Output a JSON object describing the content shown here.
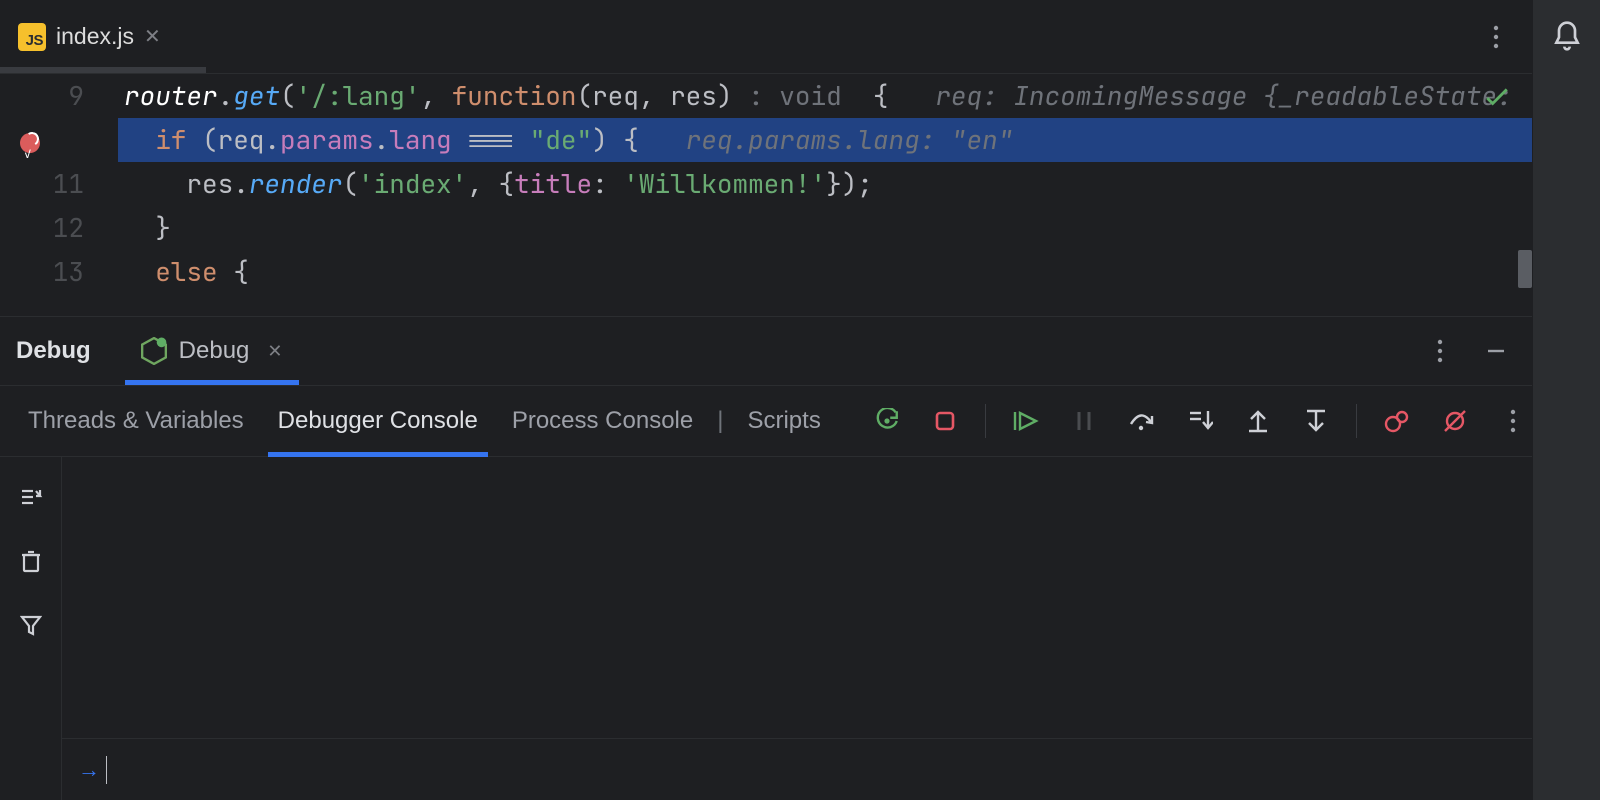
{
  "tab": {
    "icon_text": "JS",
    "title": "index.js"
  },
  "editor": {
    "lines": [
      {
        "num": "9"
      },
      {
        "num": ""
      },
      {
        "num": "11"
      },
      {
        "num": "12"
      },
      {
        "num": "13"
      }
    ],
    "row9": {
      "id": "router",
      "fn": "get",
      "route_str": "'/:lang'",
      "kw_func": "function",
      "params": "req, res",
      "ret_hint": ": void",
      "inlay": "req: IncomingMessage {_readableState: "
    },
    "row10": {
      "kw_if": "if",
      "expr_req": "req",
      "expr_params": "params",
      "expr_lang": "lang",
      "op": "===",
      "str": "\"de\"",
      "inlay": "req.params.lang: \"en\""
    },
    "row11": {
      "obj": "res",
      "fn": "render",
      "arg1": "'index'",
      "prop": "title",
      "str": "'Willkommen!'"
    },
    "row12": {
      "brace": "}"
    },
    "row13": {
      "kw_else": "else",
      "brace": "{"
    }
  },
  "debug": {
    "title": "Debug",
    "session_label": "Debug",
    "sub_tabs": {
      "threads": "Threads & Variables",
      "console": "Debugger Console",
      "process": "Process Console",
      "scripts": "Scripts"
    }
  }
}
